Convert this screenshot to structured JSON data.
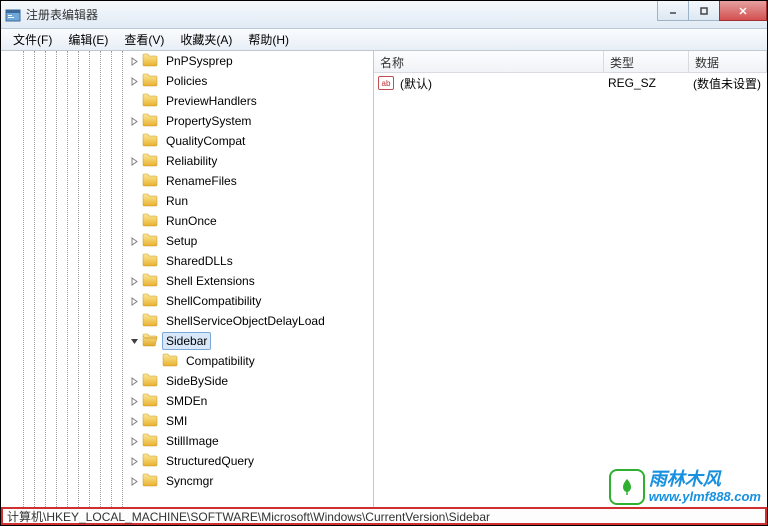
{
  "window": {
    "title": "注册表编辑器"
  },
  "menubar": {
    "items": [
      {
        "label": "文件(F)"
      },
      {
        "label": "编辑(E)"
      },
      {
        "label": "查看(V)"
      },
      {
        "label": "收藏夹(A)"
      },
      {
        "label": "帮助(H)"
      }
    ]
  },
  "tree": {
    "items": [
      {
        "label": "PnPSysprep",
        "expandable": true
      },
      {
        "label": "Policies",
        "expandable": true
      },
      {
        "label": "PreviewHandlers",
        "expandable": false
      },
      {
        "label": "PropertySystem",
        "expandable": true
      },
      {
        "label": "QualityCompat",
        "expandable": false
      },
      {
        "label": "Reliability",
        "expandable": true
      },
      {
        "label": "RenameFiles",
        "expandable": false
      },
      {
        "label": "Run",
        "expandable": false
      },
      {
        "label": "RunOnce",
        "expandable": false
      },
      {
        "label": "Setup",
        "expandable": true
      },
      {
        "label": "SharedDLLs",
        "expandable": false
      },
      {
        "label": "Shell Extensions",
        "expandable": true
      },
      {
        "label": "ShellCompatibility",
        "expandable": true
      },
      {
        "label": "ShellServiceObjectDelayLoad",
        "expandable": false
      },
      {
        "label": "Sidebar",
        "expandable": true,
        "expanded": true,
        "selected": true
      },
      {
        "label": "Compatibility",
        "expandable": false,
        "child": true
      },
      {
        "label": "SideBySide",
        "expandable": true
      },
      {
        "label": "SMDEn",
        "expandable": true
      },
      {
        "label": "SMI",
        "expandable": true
      },
      {
        "label": "StillImage",
        "expandable": true
      },
      {
        "label": "StructuredQuery",
        "expandable": true
      },
      {
        "label": "Syncmgr",
        "expandable": true
      }
    ]
  },
  "list": {
    "columns": {
      "name": "名称",
      "type": "类型",
      "data": "数据"
    },
    "rows": [
      {
        "name": "(默认)",
        "type": "REG_SZ",
        "data": "(数值未设置)"
      }
    ]
  },
  "statusbar": {
    "path": "计算机\\HKEY_LOCAL_MACHINE\\SOFTWARE\\Microsoft\\Windows\\CurrentVersion\\Sidebar"
  },
  "watermark": {
    "cn": "雨林木风",
    "url": "www.ylmf888.com"
  }
}
